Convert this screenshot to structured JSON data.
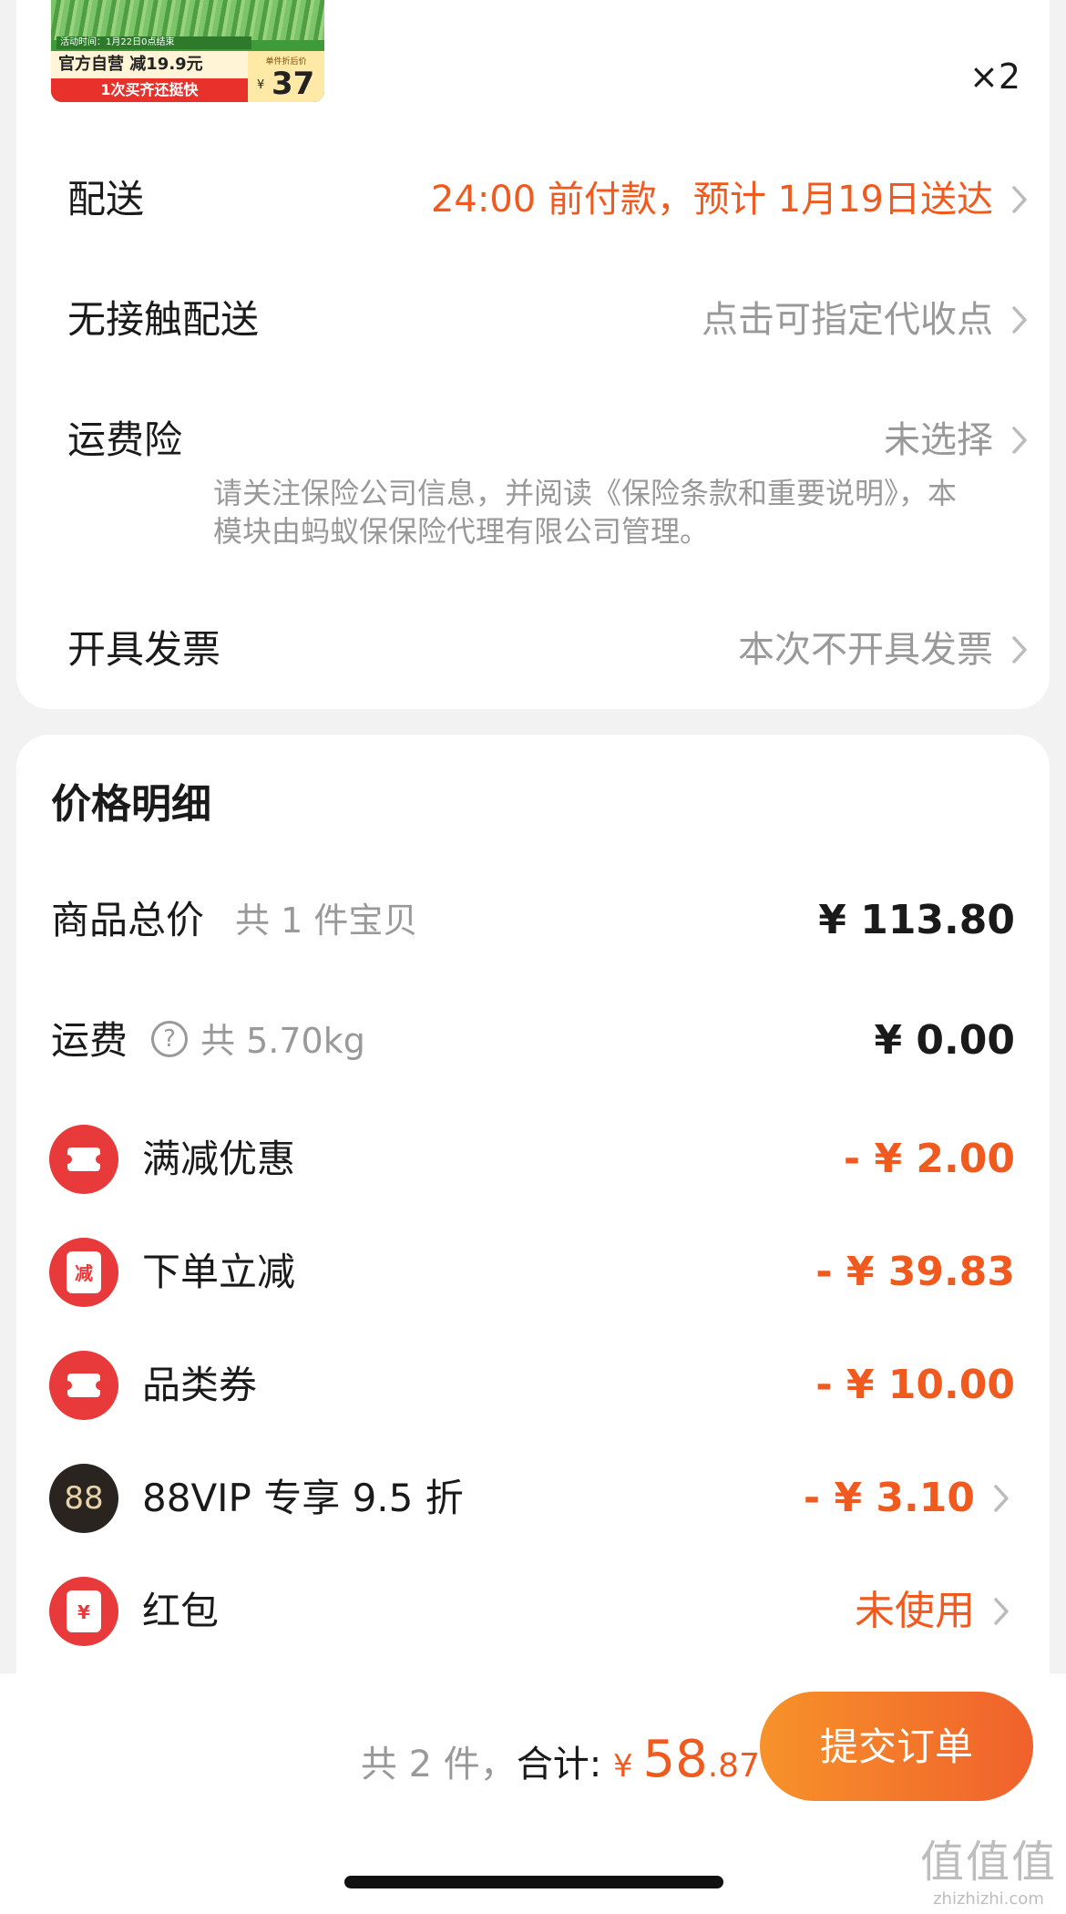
{
  "product": {
    "activity_text": "活动时间：1月22日0点结束",
    "tag": "官方自营 减19.9元",
    "slogan": "1次买齐还挺快",
    "price_caption": "单件折后价",
    "price_currency": "¥",
    "price": "37",
    "quantity": "×2"
  },
  "order_rows": {
    "delivery": {
      "label": "配送",
      "value": "24:00 前付款，预计 1月19日送达"
    },
    "contactless": {
      "label": "无接触配送",
      "value": "点击可指定代收点"
    },
    "shipping_insurance": {
      "label": "运费险",
      "value": "未选择",
      "note": "请关注保险公司信息，并阅读《保险条款和重要说明》，本模块由蚂蚁保保险代理有限公司管理。"
    },
    "invoice": {
      "label": "开具发票",
      "value": "本次不开具发票"
    }
  },
  "price_detail": {
    "title": "价格明细",
    "goods_total": {
      "label": "商品总价",
      "sub": "共 1 件宝贝",
      "amount": "¥ 113.80"
    },
    "shipping_fee": {
      "label": "运费",
      "sub": "共 5.70kg",
      "amount": "¥ 0.00"
    },
    "discounts": [
      {
        "label": "满减优惠",
        "amount": "- ¥ 2.00",
        "icon": "ticket-icon"
      },
      {
        "label": "下单立减",
        "amount": "- ¥ 39.83",
        "icon": "instant-discount-icon",
        "icon_text": "减"
      },
      {
        "label": "品类券",
        "amount": "- ¥ 10.00",
        "icon": "ticket-icon"
      },
      {
        "label": "88VIP 专享 9.5 折",
        "amount": "- ¥ 3.10",
        "icon": "vip-88-icon",
        "icon_text": "88"
      },
      {
        "label": "红包",
        "amount": "未使用",
        "icon": "red-packet-icon",
        "icon_text": "¥"
      }
    ]
  },
  "footer": {
    "count": "共 2 件，",
    "sum_label": "合计: ",
    "currency": "¥ ",
    "total_int": "58",
    "total_dec": ".87",
    "submit_label": "提交订单"
  },
  "watermark": {
    "logo": "值值值",
    "text": "zhizhizhi.com"
  },
  "colors": {
    "accent": "#f05a1e",
    "discount_icon": "#e83a3a",
    "vip_icon": "#2a2421"
  }
}
